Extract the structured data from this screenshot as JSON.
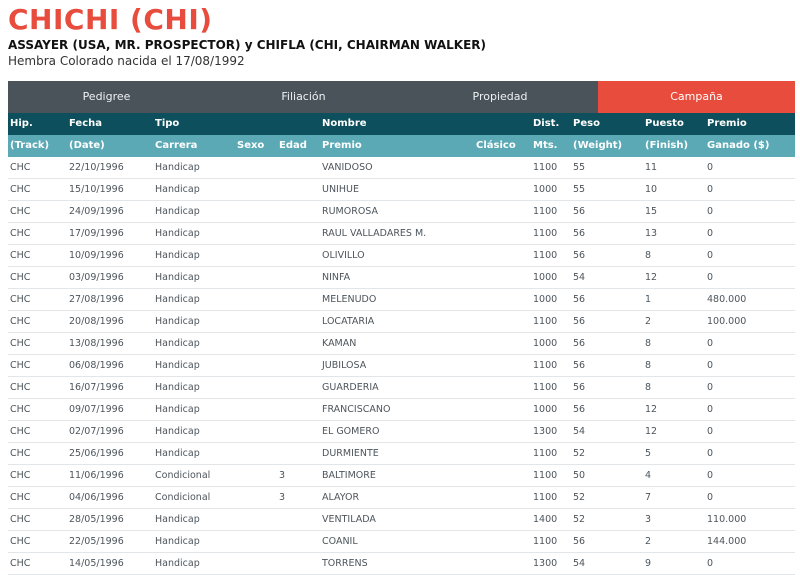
{
  "horse": {
    "name": "CHICHI (CHI)",
    "parents": "ASSAYER (USA, MR. PROSPECTOR) y CHIFLA (CHI, CHAIRMAN WALKER)",
    "birth": "Hembra Colorado nacida el 17/08/1992"
  },
  "tabs": [
    {
      "label": "Pedigree",
      "active": false
    },
    {
      "label": "Filiación",
      "active": false
    },
    {
      "label": "Propiedad",
      "active": false
    },
    {
      "label": "Campaña",
      "active": true
    }
  ],
  "table": {
    "header_top": [
      "Hip.",
      "Fecha",
      "Tipo",
      "",
      "",
      "Nombre",
      "",
      "Dist.",
      "Peso",
      "Puesto",
      "Premio"
    ],
    "header_bottom": [
      "(Track)",
      "(Date)",
      "Carrera",
      "Sexo",
      "Edad",
      "Premio",
      "Clásico",
      "Mts.",
      "(Weight)",
      "(Finish)",
      "Ganado ($)"
    ],
    "rows": [
      [
        "CHC",
        "22/10/1996",
        "Handicap",
        "",
        "",
        "VANIDOSO",
        "",
        "1100",
        "55",
        "11",
        "0"
      ],
      [
        "CHC",
        "15/10/1996",
        "Handicap",
        "",
        "",
        "UNIHUE",
        "",
        "1000",
        "55",
        "10",
        "0"
      ],
      [
        "CHC",
        "24/09/1996",
        "Handicap",
        "",
        "",
        "RUMOROSA",
        "",
        "1100",
        "56",
        "15",
        "0"
      ],
      [
        "CHC",
        "17/09/1996",
        "Handicap",
        "",
        "",
        "RAUL VALLADARES M.",
        "",
        "1100",
        "56",
        "13",
        "0"
      ],
      [
        "CHC",
        "10/09/1996",
        "Handicap",
        "",
        "",
        "OLIVILLO",
        "",
        "1100",
        "56",
        "8",
        "0"
      ],
      [
        "CHC",
        "03/09/1996",
        "Handicap",
        "",
        "",
        "NINFA",
        "",
        "1000",
        "54",
        "12",
        "0"
      ],
      [
        "CHC",
        "27/08/1996",
        "Handicap",
        "",
        "",
        "MELENUDO",
        "",
        "1000",
        "56",
        "1",
        "480.000"
      ],
      [
        "CHC",
        "20/08/1996",
        "Handicap",
        "",
        "",
        "LOCATARIA",
        "",
        "1100",
        "56",
        "2",
        "100.000"
      ],
      [
        "CHC",
        "13/08/1996",
        "Handicap",
        "",
        "",
        "KAMAN",
        "",
        "1000",
        "56",
        "8",
        "0"
      ],
      [
        "CHC",
        "06/08/1996",
        "Handicap",
        "",
        "",
        "JUBILOSA",
        "",
        "1100",
        "56",
        "8",
        "0"
      ],
      [
        "CHC",
        "16/07/1996",
        "Handicap",
        "",
        "",
        "GUARDERIA",
        "",
        "1100",
        "56",
        "8",
        "0"
      ],
      [
        "CHC",
        "09/07/1996",
        "Handicap",
        "",
        "",
        "FRANCISCANO",
        "",
        "1000",
        "56",
        "12",
        "0"
      ],
      [
        "CHC",
        "02/07/1996",
        "Handicap",
        "",
        "",
        "EL GOMERO",
        "",
        "1300",
        "54",
        "12",
        "0"
      ],
      [
        "CHC",
        "25/06/1996",
        "Handicap",
        "",
        "",
        "DURMIENTE",
        "",
        "1100",
        "52",
        "5",
        "0"
      ],
      [
        "CHC",
        "11/06/1996",
        "Condicional",
        "",
        "3",
        "BALTIMORE",
        "",
        "1100",
        "50",
        "4",
        "0"
      ],
      [
        "CHC",
        "04/06/1996",
        "Condicional",
        "",
        "3",
        "ALAYOR",
        "",
        "1100",
        "52",
        "7",
        "0"
      ],
      [
        "CHC",
        "28/05/1996",
        "Handicap",
        "",
        "",
        "VENTILADA",
        "",
        "1400",
        "52",
        "3",
        "110.000"
      ],
      [
        "CHC",
        "22/05/1996",
        "Handicap",
        "",
        "",
        "COANIL",
        "",
        "1100",
        "56",
        "2",
        "144.000"
      ],
      [
        "CHC",
        "14/05/1996",
        "Handicap",
        "",
        "",
        "TORRENS",
        "",
        "1300",
        "54",
        "9",
        "0"
      ]
    ]
  }
}
